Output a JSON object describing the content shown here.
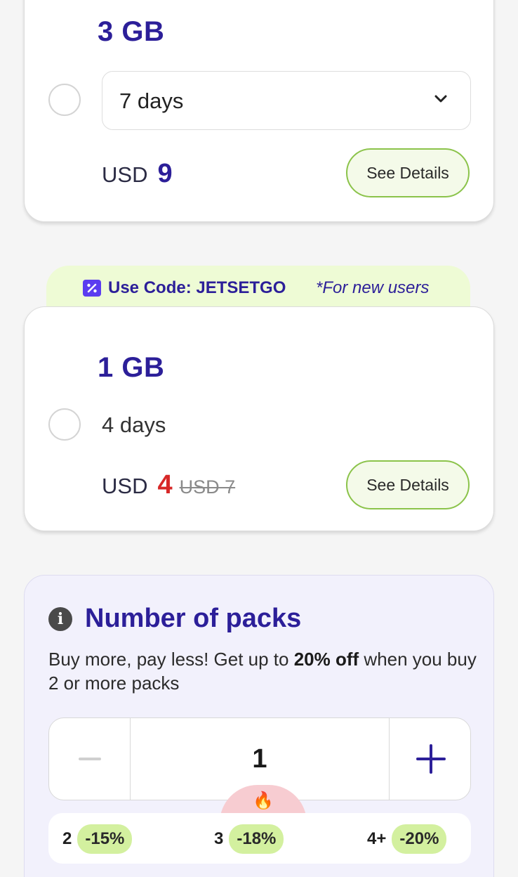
{
  "plans": [
    {
      "size": "3 GB",
      "duration": "7 days",
      "currency": "USD",
      "price": "9",
      "details_label": "See Details"
    },
    {
      "size": "1 GB",
      "duration": "4 days",
      "currency": "USD",
      "price": "4",
      "old_price": "USD 7",
      "details_label": "See Details"
    }
  ],
  "promo": {
    "code_label": "Use Code: JETSETGO",
    "note": "*For new users",
    "icon": "percent-icon"
  },
  "packs": {
    "title": "Number of packs",
    "desc_prefix": "Buy more, pay less! Get up to ",
    "desc_bold": "20% off",
    "desc_suffix": " when you buy 2 or more packs",
    "count": "1",
    "fire": "🔥",
    "tiers": [
      {
        "qty": "2",
        "discount": "-15%"
      },
      {
        "qty": "3",
        "discount": "-18%"
      },
      {
        "qty": "4+",
        "discount": "-20%"
      }
    ]
  },
  "colors": {
    "brand": "#2c1f99",
    "sale": "#d72828",
    "accent_green": "#8bc34a",
    "discount_bg": "#d3f09f"
  }
}
